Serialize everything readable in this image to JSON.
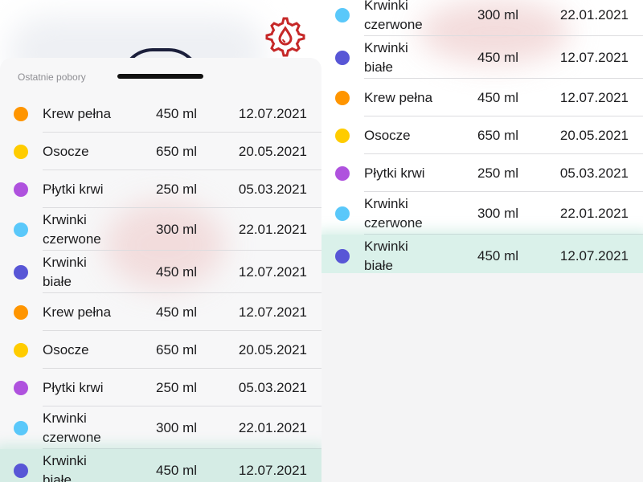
{
  "header": {
    "settings_icon": "gear-blood-drop-icon",
    "accent_color": "#c62828"
  },
  "sheet": {
    "title": "Ostatnie pobory"
  },
  "colors": {
    "orange": "#ff9500",
    "yellow": "#ffcc00",
    "purple": "#af52de",
    "lightblue": "#5ac8fa",
    "indigo": "#5856d6",
    "highlight": "#96d6c4"
  },
  "left_list": [
    {
      "type": "Krew pełna",
      "volume": "450 ml",
      "date": "12.07.2021",
      "color": "#ff9500"
    },
    {
      "type": "Osocze",
      "volume": "650 ml",
      "date": "20.05.2021",
      "color": "#ffcc00"
    },
    {
      "type": "Płytki krwi",
      "volume": "250 ml",
      "date": "05.03.2021",
      "color": "#af52de"
    },
    {
      "type": "Krwinki czerwone",
      "volume": "300 ml",
      "date": "22.01.2021",
      "color": "#5ac8fa"
    },
    {
      "type": "Krwinki białe",
      "volume": "450 ml",
      "date": "12.07.2021",
      "color": "#5856d6"
    },
    {
      "type": "Krew pełna",
      "volume": "450 ml",
      "date": "12.07.2021",
      "color": "#ff9500"
    },
    {
      "type": "Osocze",
      "volume": "650 ml",
      "date": "20.05.2021",
      "color": "#ffcc00"
    },
    {
      "type": "Płytki krwi",
      "volume": "250 ml",
      "date": "05.03.2021",
      "color": "#af52de"
    },
    {
      "type": "Krwinki czerwone",
      "volume": "300 ml",
      "date": "22.01.2021",
      "color": "#5ac8fa"
    },
    {
      "type": "Krwinki białe",
      "volume": "450 ml",
      "date": "12.07.2021",
      "color": "#5856d6",
      "highlighted": true
    }
  ],
  "right_list": [
    {
      "type": "Krwinki czerwone",
      "volume": "300 ml",
      "date": "22.01.2021",
      "color": "#5ac8fa"
    },
    {
      "type": "Krwinki białe",
      "volume": "450 ml",
      "date": "12.07.2021",
      "color": "#5856d6"
    },
    {
      "type": "Krew pełna",
      "volume": "450 ml",
      "date": "12.07.2021",
      "color": "#ff9500"
    },
    {
      "type": "Osocze",
      "volume": "650 ml",
      "date": "20.05.2021",
      "color": "#ffcc00"
    },
    {
      "type": "Płytki krwi",
      "volume": "250 ml",
      "date": "05.03.2021",
      "color": "#af52de"
    },
    {
      "type": "Krwinki czerwone",
      "volume": "300 ml",
      "date": "22.01.2021",
      "color": "#5ac8fa"
    },
    {
      "type": "Krwinki białe",
      "volume": "450 ml",
      "date": "12.07.2021",
      "color": "#5856d6",
      "highlighted": true
    }
  ]
}
